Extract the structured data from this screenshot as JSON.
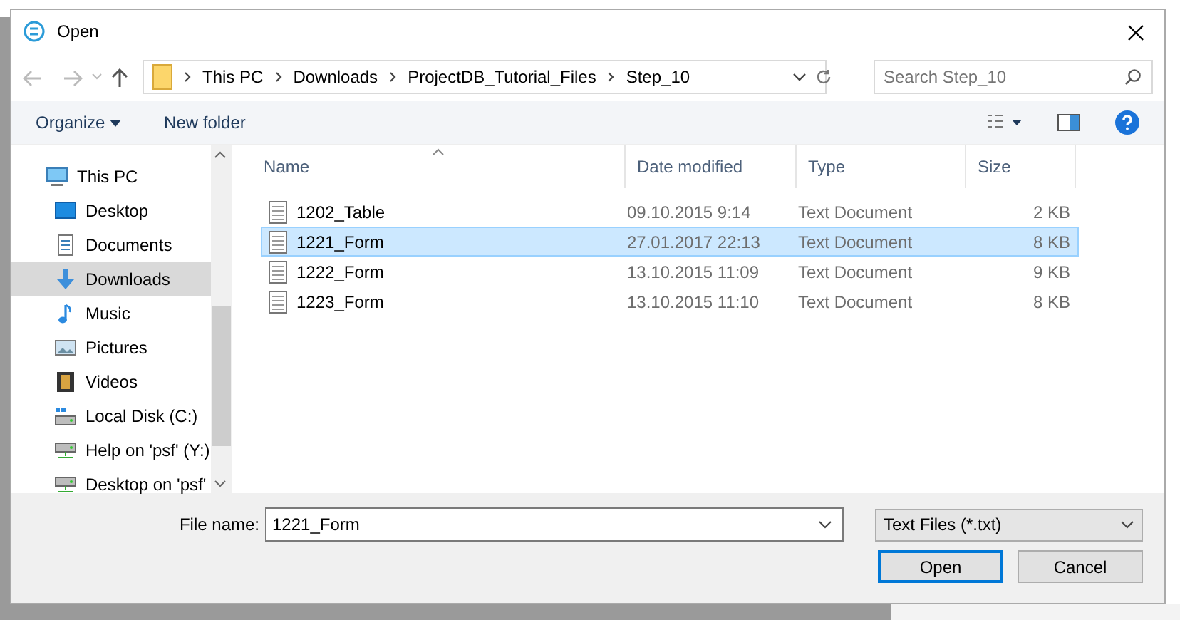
{
  "window": {
    "title": "Open"
  },
  "address_bar": {
    "path": [
      "This PC",
      "Downloads",
      "ProjectDB_Tutorial_Files",
      "Step_10"
    ]
  },
  "search": {
    "placeholder": "Search Step_10"
  },
  "toolbar": {
    "organize": "Organize",
    "new_folder": "New folder"
  },
  "sidebar": {
    "items": [
      {
        "label": "This PC",
        "kind": "pc",
        "selected": false,
        "children": [
          {
            "label": "Desktop",
            "kind": "desktop",
            "selected": false
          },
          {
            "label": "Documents",
            "kind": "documents",
            "selected": false
          },
          {
            "label": "Downloads",
            "kind": "downloads",
            "selected": true
          },
          {
            "label": "Music",
            "kind": "music",
            "selected": false
          },
          {
            "label": "Pictures",
            "kind": "pictures",
            "selected": false
          },
          {
            "label": "Videos",
            "kind": "videos",
            "selected": false
          },
          {
            "label": "Local Disk (C:)",
            "kind": "disk",
            "selected": false
          },
          {
            "label": "Help on 'psf' (Y:)",
            "kind": "netdrive",
            "selected": false
          },
          {
            "label": "Desktop on 'psf'",
            "kind": "netdrive",
            "selected": false
          }
        ]
      }
    ]
  },
  "table": {
    "columns": [
      "Name",
      "Date modified",
      "Type",
      "Size"
    ],
    "rows": [
      {
        "name": "1202_Table",
        "date": "09.10.2015 9:14",
        "type": "Text Document",
        "size": "2 KB",
        "selected": false
      },
      {
        "name": "1221_Form",
        "date": "27.01.2017 22:13",
        "type": "Text Document",
        "size": "8 KB",
        "selected": true
      },
      {
        "name": "1222_Form",
        "date": "13.10.2015 11:09",
        "type": "Text Document",
        "size": "9 KB",
        "selected": false
      },
      {
        "name": "1223_Form",
        "date": "13.10.2015 11:10",
        "type": "Text Document",
        "size": "8 KB",
        "selected": false
      }
    ]
  },
  "file_name": {
    "label": "File name:",
    "value": "1221_Form"
  },
  "file_type": {
    "value": "Text Files (*.txt)"
  },
  "buttons": [
    {
      "label": "Open",
      "default": true
    },
    {
      "label": "Cancel",
      "default": false
    }
  ]
}
